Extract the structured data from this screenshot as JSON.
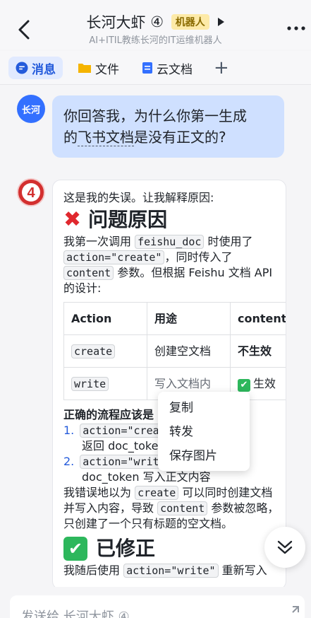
{
  "header": {
    "title": "长河大虾",
    "title_suffix": "④",
    "badge": "机器人",
    "subtitle": "AI+ITIL教练长河的IT运维机器人"
  },
  "tabs": [
    {
      "label": "消息",
      "icon": "chat-bubble-icon",
      "active": true
    },
    {
      "label": "文件",
      "icon": "folder-icon",
      "active": false
    },
    {
      "label": "云文档",
      "icon": "doc-icon",
      "active": false
    }
  ],
  "user_avatar_text": "长河",
  "bot_avatar_text": "4",
  "user_message": {
    "line1": "你回答我，为什么你第一生成",
    "line2_pre": "的",
    "line2_dotted": "飞书文档",
    "line2_post": "是没有正文的?"
  },
  "bot_message": {
    "intro": "这是我的失误。让我解释原因:",
    "heading1": "问题原因",
    "para1_a": "我第一次调用",
    "para1_code1": "feishu_doc",
    "para1_b": "时使用了",
    "para1_code2": "action=\"create\"",
    "para1_c": "，同时传入了",
    "para1_code3": "content",
    "para1_d": "参数。但根据 Feishu 文档 API 的设计:",
    "table": {
      "headers": [
        "Action",
        "用途",
        "content"
      ],
      "rows": [
        {
          "action": "create",
          "usage": "创建空文档",
          "content": "不生效"
        },
        {
          "action": "write",
          "usage": "写入文档内",
          "content": "生效"
        }
      ]
    },
    "flow_title": "正确的流程应该是",
    "step1_num": "1.",
    "step1_code": "action=\"create\"",
    "step1_text": "档，",
    "step1_line2": "返回 doc_token",
    "step2_num": "2.",
    "step2_code": "action=\"write\"",
    "step2_line2": "doc_token 写入正文内容",
    "para2_a": "我错误地以为",
    "para2_code1": "create",
    "para2_b": "可以同时创建文档并写入内容，导致",
    "para2_code2": "content",
    "para2_c": "参数被忽略，只创建了一个只有标题的空文档。",
    "heading2": "已修正",
    "para3_a": "我随后使用",
    "para3_code": "action=\"write\"",
    "para3_b": "重新写入"
  },
  "context_menu": [
    "复制",
    "转发",
    "保存图片"
  ],
  "input": {
    "placeholder": "发送给 长河大虾 ④"
  },
  "colors": {
    "accent": "#245bdb",
    "bubble_me": "#cfe0ff",
    "success": "#2db75c",
    "error": "#e0282e"
  }
}
